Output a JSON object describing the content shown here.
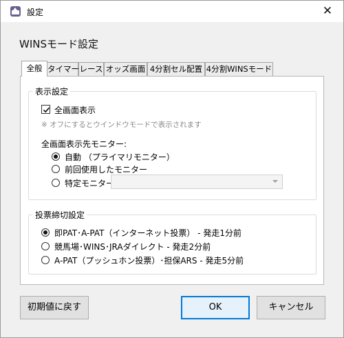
{
  "window": {
    "title": "設定",
    "close_glyph": "✕"
  },
  "header": "WINSモード設定",
  "tabs": [
    {
      "label": "全般",
      "active": true
    },
    {
      "label": "タイマー"
    },
    {
      "label": "レース"
    },
    {
      "label": "オッズ画面"
    },
    {
      "label": "4分割セル配置"
    },
    {
      "label": "4分割WINSモード"
    }
  ],
  "display_group": {
    "title": "表示設定",
    "fullscreen_checkbox": {
      "label": "全画面表示",
      "checked": true
    },
    "note": "※ オフにするとウインドウモードで表示されます",
    "monitor_label": "全画面表示先モニター:",
    "monitor_options": [
      {
        "label": "自動 （プライマリモニター）",
        "checked": true
      },
      {
        "label": "前回使用したモニター",
        "checked": false
      },
      {
        "label": "特定モニター:",
        "checked": false
      }
    ],
    "monitor_select_value": ""
  },
  "vote_group": {
    "title": "投票締切設定",
    "options": [
      {
        "label": "即PAT･A-PAT（インターネット投票） - 発走1分前",
        "checked": true
      },
      {
        "label": "競馬場･WINS･JRAダイレクト - 発走2分前",
        "checked": false
      },
      {
        "label": "A-PAT（プッシュホン投票）･担保ARS - 発走5分前",
        "checked": false
      }
    ]
  },
  "buttons": {
    "reset": "初期値に戻す",
    "ok": "OK",
    "cancel": "キャンセル"
  }
}
